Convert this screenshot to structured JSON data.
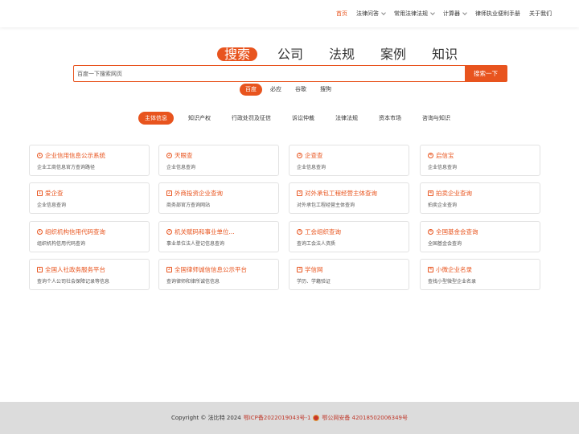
{
  "nav": {
    "items": [
      {
        "label": "首页",
        "active": true,
        "dropdown": false
      },
      {
        "label": "法律问答",
        "active": false,
        "dropdown": true
      },
      {
        "label": "常用法律法规",
        "active": false,
        "dropdown": true
      },
      {
        "label": "计算器",
        "active": false,
        "dropdown": true
      },
      {
        "label": "律师执业便利手册",
        "active": false,
        "dropdown": false
      },
      {
        "label": "关于我们",
        "active": false,
        "dropdown": false
      }
    ]
  },
  "search_types": [
    {
      "label": "搜索",
      "active": true
    },
    {
      "label": "公司",
      "active": false
    },
    {
      "label": "法规",
      "active": false
    },
    {
      "label": "案例",
      "active": false
    },
    {
      "label": "知识",
      "active": false
    }
  ],
  "search": {
    "placeholder": "百度一下搜索网页",
    "button_label": "搜索一下"
  },
  "engines": [
    {
      "label": "百度",
      "active": true
    },
    {
      "label": "必应",
      "active": false
    },
    {
      "label": "谷歌",
      "active": false
    },
    {
      "label": "搜狗",
      "active": false
    }
  ],
  "categories": [
    {
      "label": "主体信息",
      "active": true
    },
    {
      "label": "知识产权",
      "active": false
    },
    {
      "label": "行政处罚及征信",
      "active": false
    },
    {
      "label": "诉讼仲裁",
      "active": false
    },
    {
      "label": "法律法规",
      "active": false
    },
    {
      "label": "资本市场",
      "active": false
    },
    {
      "label": "咨询与知识",
      "active": false
    }
  ],
  "cards": [
    {
      "icon": "1",
      "shape": "circle",
      "title": "企业信用信息公示系统",
      "desc": "企业工商信息官方查询路径"
    },
    {
      "icon": "2",
      "shape": "circle",
      "title": "天眼查",
      "desc": "企业信息查询"
    },
    {
      "icon": "3",
      "shape": "circle",
      "title": "企查查",
      "desc": "企业信息查询"
    },
    {
      "icon": "4",
      "shape": "circle",
      "title": "启信宝",
      "desc": "企业信息查询"
    },
    {
      "icon": "1",
      "shape": "square",
      "title": "爱企查",
      "desc": "企业信息查询"
    },
    {
      "icon": "2",
      "shape": "square",
      "title": "外商投资企业查询",
      "desc": "商务部官方查询网站"
    },
    {
      "icon": "3",
      "shape": "square",
      "title": "对外承包工程经营主体查询",
      "desc": "对外承包工程经营主体查询"
    },
    {
      "icon": "4",
      "shape": "square",
      "title": "拍卖企业查询",
      "desc": "拍卖企业查询"
    },
    {
      "icon": "1",
      "shape": "circle",
      "title": "组织机构信用代码查询",
      "desc": "组织机构信用代码查询"
    },
    {
      "icon": "2",
      "shape": "circle",
      "title": "机关赋码和事业单位...",
      "desc": "事业单位法人登记信息查询"
    },
    {
      "icon": "3",
      "shape": "circle",
      "title": "工会组织查询",
      "desc": "查询工会法人资质"
    },
    {
      "icon": "4",
      "shape": "circle",
      "title": "全国基金会查询",
      "desc": "全国基金会查询"
    },
    {
      "icon": "1",
      "shape": "square",
      "title": "全国人社政务服务平台",
      "desc": "查询个人公司社会保障记录等信息"
    },
    {
      "icon": "2",
      "shape": "square",
      "title": "全国律师诚信信息公示平台",
      "desc": "查询律师和律所诚信信息"
    },
    {
      "icon": "3",
      "shape": "square",
      "title": "学信网",
      "desc": "学历、学籍验证"
    },
    {
      "icon": "4",
      "shape": "square",
      "title": "小微企业名录",
      "desc": "查找小型微型企业名录"
    }
  ],
  "footer": {
    "copyright": "Copyright © 法比特 2024",
    "icp": "鄂ICP备2022019043号-1",
    "police": "鄂公网安备 42018502006349号"
  },
  "colors": {
    "accent": "#e8541e",
    "footer_bg": "#dcdcdc"
  }
}
